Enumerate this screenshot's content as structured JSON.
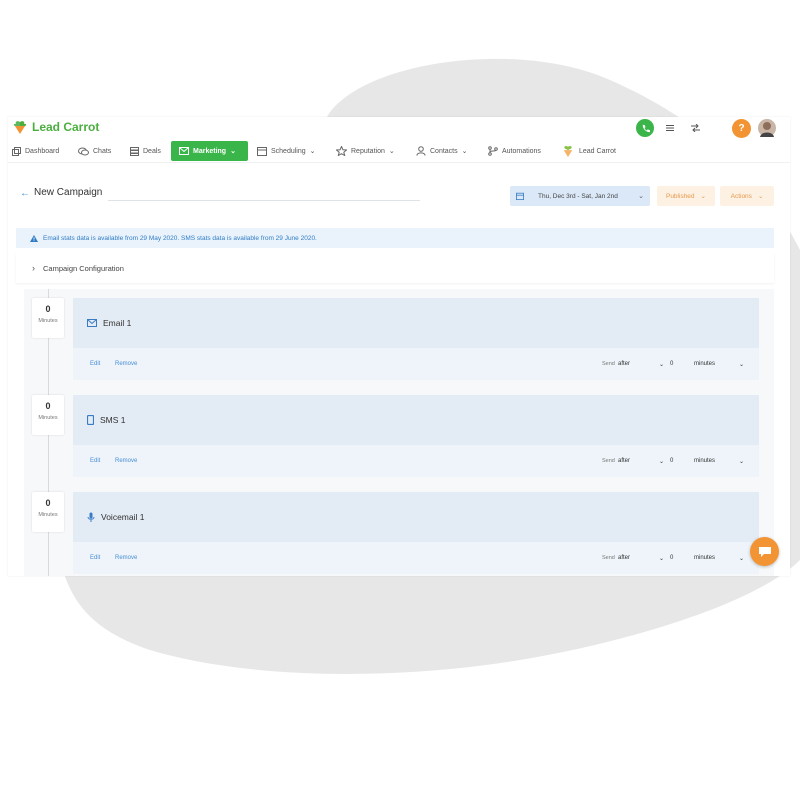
{
  "brand": {
    "name": "Lead Carrot",
    "accent": "#39b54a",
    "orange": "#f29433"
  },
  "nav": {
    "items": [
      {
        "label": "Dashboard",
        "icon": "dashboard-icon"
      },
      {
        "label": "Chats",
        "icon": "chat-icon"
      },
      {
        "label": "Deals",
        "icon": "deals-icon"
      },
      {
        "label": "Marketing",
        "icon": "mail-icon",
        "active": true
      },
      {
        "label": "Scheduling",
        "icon": "calendar-icon"
      },
      {
        "label": "Reputation",
        "icon": "star-icon"
      },
      {
        "label": "Contacts",
        "icon": "user-icon"
      },
      {
        "label": "Automations",
        "icon": "branch-icon"
      },
      {
        "label": "Lead Carrot",
        "icon": "carrot-icon"
      }
    ]
  },
  "topbar": {
    "help_label": "?"
  },
  "header": {
    "back_label": "←",
    "title": "New Campaign",
    "date_range": "Thu, Dec 3rd - Sat, Jan 2nd",
    "status_label": "Published",
    "actions_label": "Actions"
  },
  "alert": {
    "text": "Email stats data is available from 29 May 2020. SMS stats data is available from 29 June 2020."
  },
  "config": {
    "label": "Campaign Configuration"
  },
  "steps": [
    {
      "delay": "0",
      "delay_unit": "Minutes",
      "name": "Email 1",
      "icon": "mail-icon",
      "edit": "Edit",
      "remove": "Remove",
      "send_label": "Send",
      "timing": "after",
      "amount": "0",
      "unit": "minutes"
    },
    {
      "delay": "0",
      "delay_unit": "Minutes",
      "name": "SMS 1",
      "icon": "phone-icon",
      "edit": "Edit",
      "remove": "Remove",
      "send_label": "Send",
      "timing": "after",
      "amount": "0",
      "unit": "minutes"
    },
    {
      "delay": "0",
      "delay_unit": "Minutes",
      "name": "Voicemail 1",
      "icon": "microphone-icon",
      "edit": "Edit",
      "remove": "Remove",
      "send_label": "Send",
      "timing": "after",
      "amount": "0",
      "unit": "minutes"
    }
  ]
}
